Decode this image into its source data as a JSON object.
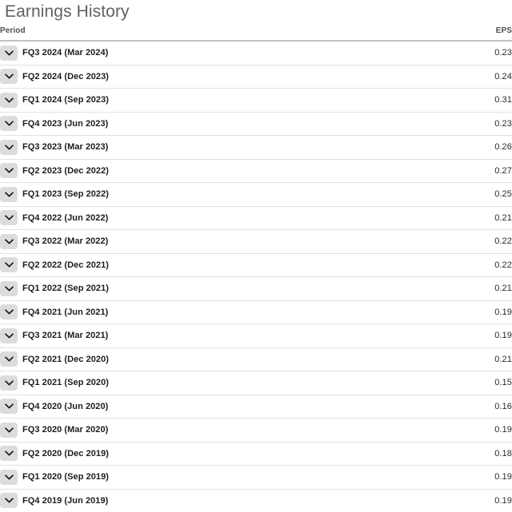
{
  "panel": {
    "title": "Earnings History"
  },
  "table": {
    "columns": {
      "period": "Period",
      "eps": "EPS"
    },
    "expand_icon": "chevron-down-icon",
    "rows": [
      {
        "period": "FQ3 2024 (Mar 2024)",
        "eps": "0.23"
      },
      {
        "period": "FQ2 2024 (Dec 2023)",
        "eps": "0.24"
      },
      {
        "period": "FQ1 2024 (Sep 2023)",
        "eps": "0.31"
      },
      {
        "period": "FQ4 2023 (Jun 2023)",
        "eps": "0.23"
      },
      {
        "period": "FQ3 2023 (Mar 2023)",
        "eps": "0.26"
      },
      {
        "period": "FQ2 2023 (Dec 2022)",
        "eps": "0.27"
      },
      {
        "period": "FQ1 2023 (Sep 2022)",
        "eps": "0.25"
      },
      {
        "period": "FQ4 2022 (Jun 2022)",
        "eps": "0.21"
      },
      {
        "period": "FQ3 2022 (Mar 2022)",
        "eps": "0.22"
      },
      {
        "period": "FQ2 2022 (Dec 2021)",
        "eps": "0.22"
      },
      {
        "period": "FQ1 2022 (Sep 2021)",
        "eps": "0.21"
      },
      {
        "period": "FQ4 2021 (Jun 2021)",
        "eps": "0.19"
      },
      {
        "period": "FQ3 2021 (Mar 2021)",
        "eps": "0.19"
      },
      {
        "period": "FQ2 2021 (Dec 2020)",
        "eps": "0.21"
      },
      {
        "period": "FQ1 2021 (Sep 2020)",
        "eps": "0.15"
      },
      {
        "period": "FQ4 2020 (Jun 2020)",
        "eps": "0.16"
      },
      {
        "period": "FQ3 2020 (Mar 2020)",
        "eps": "0.19"
      },
      {
        "period": "FQ2 2020 (Dec 2019)",
        "eps": "0.18"
      },
      {
        "period": "FQ1 2020 (Sep 2019)",
        "eps": "0.19"
      },
      {
        "period": "FQ4 2019 (Jun 2019)",
        "eps": "0.19"
      }
    ]
  },
  "colors": {
    "title": "#5c6268",
    "header_rule": "#bfc3c7",
    "row_rule": "#e2e2e2",
    "chevron_button_bg": "#dcdcdc",
    "text": "#1d1d1d"
  }
}
